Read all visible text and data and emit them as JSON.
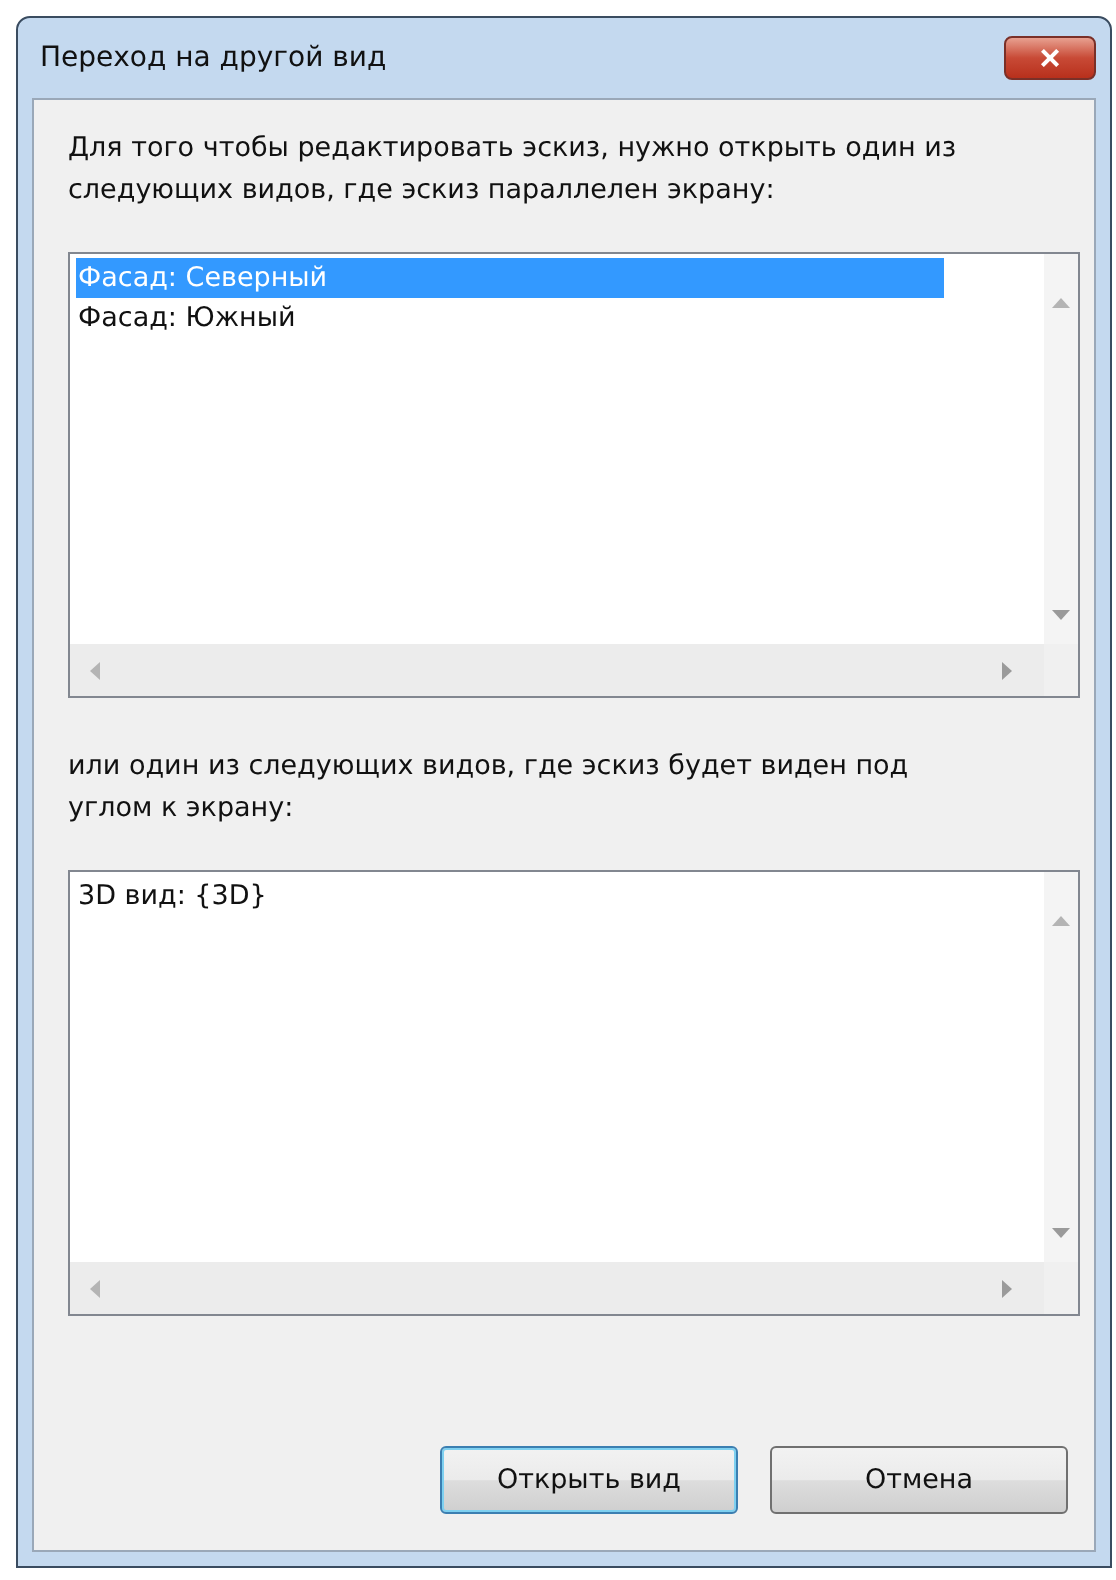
{
  "window": {
    "title": "Переход на другой вид",
    "close": "×"
  },
  "intro": "Для того чтобы редактировать эскиз, нужно открыть один из следующих видов, где эскиз параллелен экрану:",
  "parallel_views": [
    {
      "label": "Фасад: Северный",
      "selected": true
    },
    {
      "label": "Фасад: Южный",
      "selected": false
    }
  ],
  "angled_intro": "или один из следующих видов, где эскиз будет виден под углом к экрану:",
  "angled_views": [
    {
      "label": "3D вид: {3D}",
      "selected": false
    }
  ],
  "buttons": [
    {
      "label": "Открыть вид",
      "default": true
    },
    {
      "label": "Отмена",
      "default": false
    }
  ]
}
